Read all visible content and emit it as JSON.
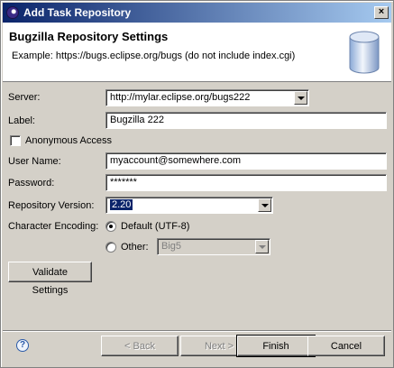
{
  "window": {
    "title": "Add Task Repository",
    "close_glyph": "×"
  },
  "header": {
    "title": "Bugzilla Repository Settings",
    "description": "Example: https://bugs.eclipse.org/bugs (do not include index.cgi)",
    "icon": "database-icon"
  },
  "form": {
    "server": {
      "label": "Server:",
      "value": "http://mylar.eclipse.org/bugs222"
    },
    "label_field": {
      "label": "Label:",
      "value": "Bugzilla 222"
    },
    "anonymous": {
      "label": "Anonymous Access",
      "checked": false
    },
    "username": {
      "label": "User Name:",
      "value": "myaccount@somewhere.com"
    },
    "password": {
      "label": "Password:",
      "value": "*******"
    },
    "version": {
      "label": "Repository Version:",
      "value": "2.20"
    },
    "encoding": {
      "label": "Character Encoding:",
      "default_option": "Default (UTF-8)",
      "other_option": "Other:",
      "other_value": "Big5",
      "selected": "default"
    },
    "validate_label": "Validate Settings"
  },
  "footer": {
    "help_glyph": "?",
    "back_label": "< Back",
    "next_label": "Next >",
    "finish_label": "Finish",
    "cancel_label": "Cancel"
  },
  "colors": {
    "titlebar_start": "#0a246a",
    "titlebar_end": "#a6caf0",
    "selection": "#0a246a",
    "dialog_bg": "#d4d0c8"
  }
}
